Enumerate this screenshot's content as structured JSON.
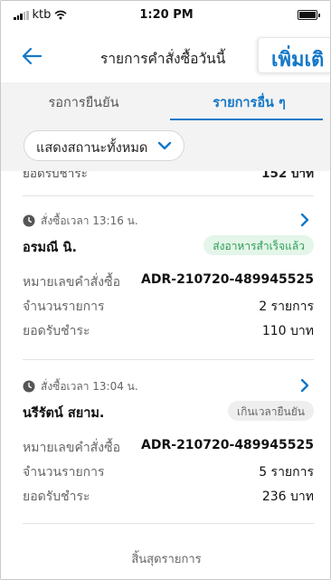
{
  "status_bar": {
    "carrier": "ktb",
    "time": "1:20 PM"
  },
  "nav": {
    "title": "รายการคำสั่งซื้อวันนี้",
    "add_more_label": "เพิ่มเติ"
  },
  "tabs": [
    {
      "label": "รอการยืนยัน",
      "active": false
    },
    {
      "label": "รายการอื่น ๆ",
      "active": true
    }
  ],
  "filter": {
    "label": "แสดงสถานะทั้งหมด"
  },
  "partial_row": {
    "label": "ยอดรับชำระ",
    "value": "152 บาท"
  },
  "orders": [
    {
      "time": "สั่งซื้อเวลา 13:16 น.",
      "name": "อรมณี นิ.",
      "status": "ส่งอาหารสำเร็จแล้ว",
      "rows": [
        {
          "label": "หมายเลขคำสั่งซื้อ",
          "value": "ADR-210720-489945525"
        },
        {
          "label": "จำนวนรายการ",
          "value": "2 รายการ"
        },
        {
          "label": "ยอดรับชำระ",
          "value": "110 บาท"
        }
      ]
    },
    {
      "time": "สั่งซื้อเวลา 13:04 น.",
      "name": "นรีรัตน์ สยาม.",
      "status": "เกินเวลายืนยัน",
      "rows": [
        {
          "label": "หมายเลขคำสั่งซื้อ",
          "value": "ADR-210720-489945525"
        },
        {
          "label": "จำนวนรายการ",
          "value": "5 รายการ"
        },
        {
          "label": "ยอดรับชำระ",
          "value": "236 บาท"
        }
      ]
    }
  ],
  "end_of_list": "สิ้นสุดรายการ",
  "icons": {
    "back": "arrow-left-icon",
    "chevron": "chevron-down-icon",
    "clock": "clock-icon",
    "arrow": "chevron-right-icon"
  },
  "colors": {
    "accent": "#1478c8",
    "success_bg": "#e4f5e9",
    "success_text": "#2c9e55",
    "neutral_badge_bg": "#eeeeee"
  }
}
